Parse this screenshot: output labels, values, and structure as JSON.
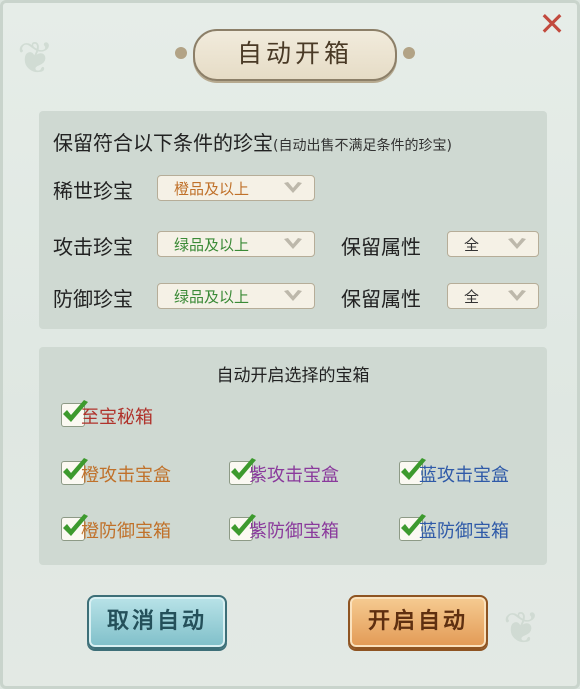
{
  "dialog": {
    "title": "自动开箱",
    "close_label": "✕"
  },
  "keep_section": {
    "heading": "保留符合以下条件的珍宝",
    "note": "(自动出售不满足条件的珍宝)",
    "rows": [
      {
        "label": "稀世珍宝",
        "value": "橙品及以上",
        "value_color": "#c0712a"
      },
      {
        "label": "攻击珍宝",
        "value": "绿品及以上",
        "value_color": "#3a8a36",
        "attr_label": "保留属性",
        "attr_value": "全"
      },
      {
        "label": "防御珍宝",
        "value": "绿品及以上",
        "value_color": "#3a8a36",
        "attr_label": "保留属性",
        "attr_value": "全"
      }
    ]
  },
  "chest_section": {
    "heading": "自动开启选择的宝箱",
    "items": [
      {
        "label": "至宝秘箱",
        "checked": true,
        "color": "#b0332c"
      },
      {
        "label": "橙攻击宝盒",
        "checked": true,
        "color": "#c0712a"
      },
      {
        "label": "紫攻击宝盒",
        "checked": true,
        "color": "#8a3a9c"
      },
      {
        "label": "蓝攻击宝盒",
        "checked": true,
        "color": "#2f5aa8"
      },
      {
        "label": "橙防御宝箱",
        "checked": true,
        "color": "#c0712a"
      },
      {
        "label": "紫防御宝箱",
        "checked": true,
        "color": "#8a3a9c"
      },
      {
        "label": "蓝防御宝箱",
        "checked": true,
        "color": "#2f5aa8"
      }
    ]
  },
  "buttons": {
    "cancel": "取消自动",
    "start": "开启自动"
  },
  "icons": {
    "close": "close-icon",
    "dropdown": "chevron-down-icon",
    "checkbox": "checkmark-icon"
  },
  "colors": {
    "check_green": "#3d9a2e",
    "cancel_button": "#7fbfc9",
    "start_button": "#e29a55",
    "close_red": "#c24a3e"
  }
}
